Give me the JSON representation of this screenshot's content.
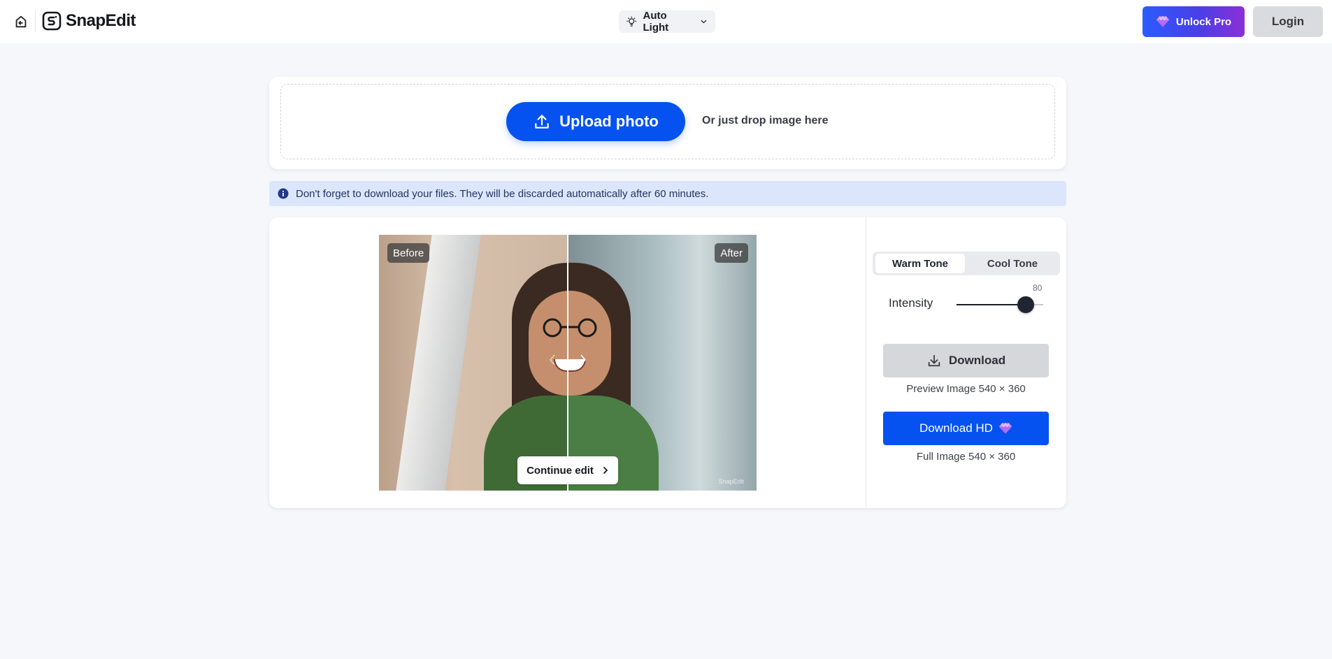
{
  "header": {
    "brand": "SnapEdit",
    "mode_label": "Auto Light",
    "unlock_label": "Unlock Pro",
    "login_label": "Login"
  },
  "upload": {
    "button_label": "Upload photo",
    "drop_text": "Or just drop image here"
  },
  "notice": {
    "text": "Don't forget to download your files. They will be discarded automatically after 60 minutes."
  },
  "preview": {
    "before_label": "Before",
    "after_label": "After",
    "watermark": "SnapEdit",
    "continue_label": "Continue edit"
  },
  "controls": {
    "tones": [
      "Warm Tone",
      "Cool Tone"
    ],
    "selected_tone": "Warm Tone",
    "intensity_label": "Intensity",
    "intensity_value": 80,
    "intensity_max": 100,
    "download_label": "Download",
    "download_caption": "Preview Image 540 × 360",
    "download_hd_label": "Download HD",
    "download_hd_caption": "Full Image 540 × 360"
  },
  "colors": {
    "primary": "#0552f0",
    "pro_gradient_start": "#2b5bff",
    "pro_gradient_end": "#8a2fd6",
    "notice_bg": "#dbe6fd"
  },
  "icons": {
    "back": "back-arrow-icon",
    "mode": "lightbulb-icon",
    "pro": "diamond-icon",
    "upload": "upload-icon",
    "info": "info-icon",
    "download": "download-icon"
  }
}
